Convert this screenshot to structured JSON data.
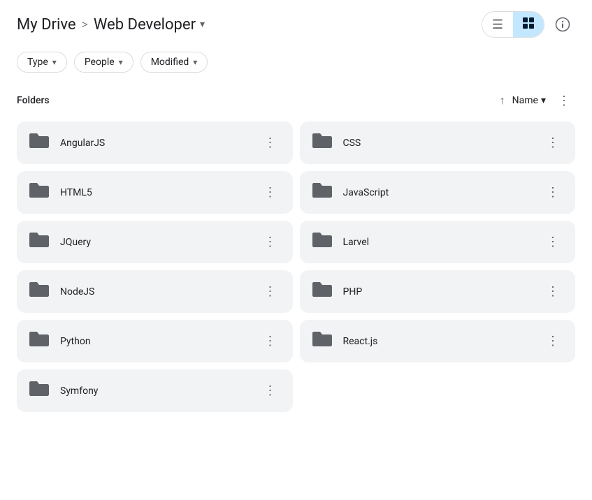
{
  "header": {
    "my_drive_label": "My Drive",
    "separator": ">",
    "current_folder": "Web Developer",
    "dropdown_char": "▾"
  },
  "view_toggle": {
    "list_icon": "☰",
    "grid_icon": "⊞",
    "active": "grid"
  },
  "info_icon": "ⓘ",
  "filters": [
    {
      "label": "Type",
      "arrow": "▾"
    },
    {
      "label": "People",
      "arrow": "▾"
    },
    {
      "label": "Modified",
      "arrow": "▾"
    }
  ],
  "section": {
    "title": "Folders",
    "sort_up_arrow": "↑",
    "sort_label": "Name",
    "sort_arrow": "▾"
  },
  "folders": [
    {
      "name": "AngularJS"
    },
    {
      "name": "CSS"
    },
    {
      "name": "HTML5"
    },
    {
      "name": "JavaScript"
    },
    {
      "name": "JQuery"
    },
    {
      "name": "Larvel"
    },
    {
      "name": "NodeJS"
    },
    {
      "name": "PHP"
    },
    {
      "name": "Python"
    },
    {
      "name": "React.js"
    },
    {
      "name": "Symfony"
    }
  ],
  "more_icon": "⋮"
}
